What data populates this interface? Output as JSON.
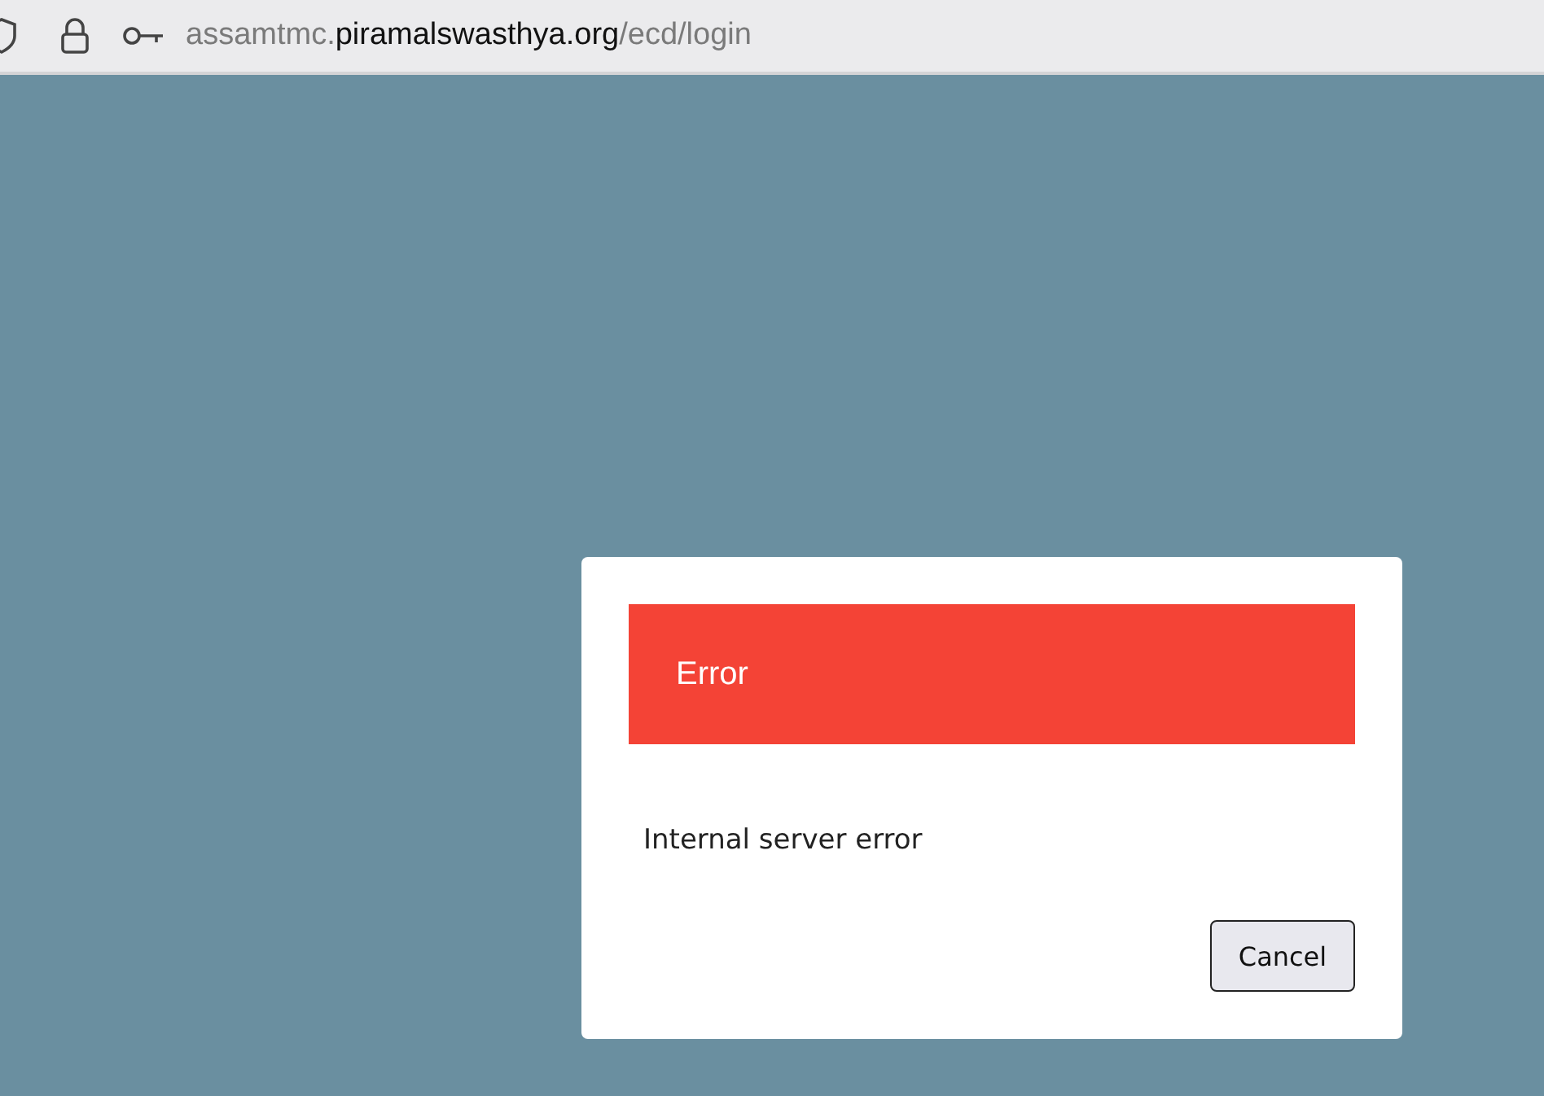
{
  "address_bar": {
    "subdomain": "assamtmc.",
    "domain": "piramalswasthya.org",
    "path": "/ecd/login"
  },
  "dialog": {
    "title": "Error",
    "message": "Internal server error",
    "buttons": [
      "Cancel"
    ]
  }
}
